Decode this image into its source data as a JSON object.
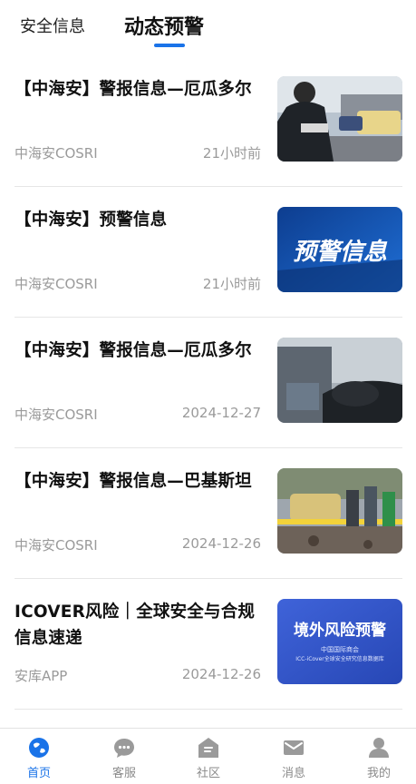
{
  "tabs": [
    {
      "label": "安全信息"
    },
    {
      "label": "动态预警"
    }
  ],
  "feed": [
    {
      "title": "【中海安】警报信息—厄瓜多尔",
      "source": "中海安COSRI",
      "time": "21小时前",
      "thumb": "police-photo"
    },
    {
      "title": "【中海安】预警信息",
      "source": "中海安COSRI",
      "time": "21小时前",
      "thumb_text": "预警信息"
    },
    {
      "title": "【中海安】警报信息—厄瓜多尔",
      "source": "中海安COSRI",
      "time": "2024-12-27",
      "thumb": "victim-photo"
    },
    {
      "title": "【中海安】警报信息—巴基斯坦",
      "source": "中海安COSRI",
      "time": "2024-12-26",
      "thumb": "blast-scene-photo"
    },
    {
      "title": "ICOVER风险｜全球安全与合规信息速递",
      "source": "安库APP",
      "time": "2024-12-26",
      "thumb_text": "境外风险预警",
      "thumb_subtext_1": "中国国际商会",
      "thumb_subtext_2": "ICC-iCover全球安全研究信息数据库"
    }
  ],
  "nav": [
    {
      "label": "首页",
      "icon": "globe-icon",
      "active": true
    },
    {
      "label": "客服",
      "icon": "chat-icon",
      "active": false
    },
    {
      "label": "社区",
      "icon": "community-icon",
      "active": false
    },
    {
      "label": "消息",
      "icon": "mail-icon",
      "active": false
    },
    {
      "label": "我的",
      "icon": "profile-icon",
      "active": false
    }
  ],
  "colors": {
    "accent": "#1a73e8",
    "muted": "#9a9a9a"
  }
}
